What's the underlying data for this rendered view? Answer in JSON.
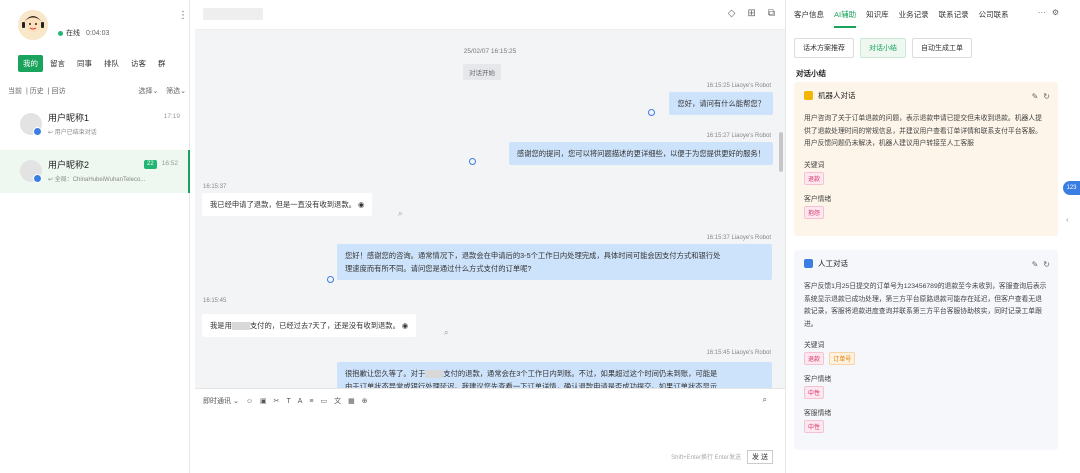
{
  "status": {
    "online": "在线",
    "duration": "0:04:03"
  },
  "left_tabs": [
    "我的",
    "留言",
    "同事",
    "排队",
    "访客",
    "群"
  ],
  "filters": {
    "current": "当前",
    "history": "历史",
    "callback": "回访",
    "select": "选择",
    "filter": "筛选"
  },
  "conversations": [
    {
      "name": "用户昵称1",
      "sub": "用户已结束对话",
      "time": "17:19",
      "badge": ""
    },
    {
      "name": "用户昵称2",
      "sub": "全局：ChinaHubeiWuhanTeleco...",
      "time": "16:52",
      "badge": "22"
    }
  ],
  "chat": {
    "date_line": "25/02/07 16:15:25",
    "start_pill": "对话开始",
    "messages": [
      {
        "type": "bot",
        "meta": "16:15:25 Liaoye's Robot",
        "text": "您好，请问有什么能帮您？"
      },
      {
        "type": "bot",
        "meta": "16:15:27 Liaoye's Robot",
        "text": "感谢您的提问，您可以将问题描述的更详细些，以便于为您提供更好的服务！"
      },
      {
        "type": "user",
        "meta": "16:15:37",
        "text": "我已经申请了退款，但是一直没有收到退款。"
      },
      {
        "type": "bot",
        "meta": "16:15:37 Liaoye's Robot",
        "text1": "您好！感谢您的咨询。通常情况下，退款会在申请后的3-5个工作日内处理完成，具体时间可能会因支付方式和银行处",
        "text2": "理速度而有所不同。请问您是通过什么方式支付的订单呢?"
      },
      {
        "type": "user",
        "meta": "16:15:45",
        "text_a": "我是用",
        "text_b": "支付的，已经过去7天了，还是没有收到退款。"
      },
      {
        "type": "bot",
        "meta": "16:15:45 Liaoye's Robot",
        "text_a": "很抱歉让您久等了。对于",
        "text_b": "支付的退款，通常会在3个工作日内到账。不过，如果超过这个时间仍未到账，可能是",
        "text3": "由于订单状态异常或银行处理延迟。我建议您先查看一下订单详情，确认退款申请是否成功提交。如果订单状态显示"
      }
    ],
    "toolbar_label": "即时通讯",
    "hint": "Shift+Enter换行 Enter发送",
    "send": "发 送"
  },
  "right": {
    "tabs": [
      "客户信息",
      "AI辅助",
      "知识库",
      "业务记录",
      "联系记录",
      "公司联系"
    ],
    "subtabs": [
      "话术方案推荐",
      "对话小结",
      "自动生成工单"
    ],
    "section_title": "对话小结",
    "robot_card": {
      "title": "机器人对话",
      "text": "用户咨询了关于订单退款的问题，表示退款申请已提交但未收到退款。机器人提供了退款处理时间的常规信息，并建议用户查看订单详情和联系支付平台客服。用户反馈问题仍未解决，机器人建议用户转接至人工客服",
      "kw_label": "关键词",
      "keywords": [
        "退款"
      ],
      "mood_label": "客户情绪",
      "mood": "抱怨"
    },
    "human_card": {
      "title": "人工对话",
      "text": "客户反馈1月25日提交的订单号为123456789的退款至今未收到，客服查询后表示系统显示退款已成功处理，第三方平台原路退款可能存在延迟，但客户查看无退款记录，客服将退款进度查询并联系第三方平台客服协助核实，同时记录工单跟进。",
      "kw_label": "关键词",
      "keywords": [
        "退款",
        "订单号"
      ],
      "mood_label": "客户情绪",
      "mood": "中性",
      "agent_mood_label": "客服情绪",
      "agent_mood": "中性"
    },
    "float_label": "123"
  }
}
